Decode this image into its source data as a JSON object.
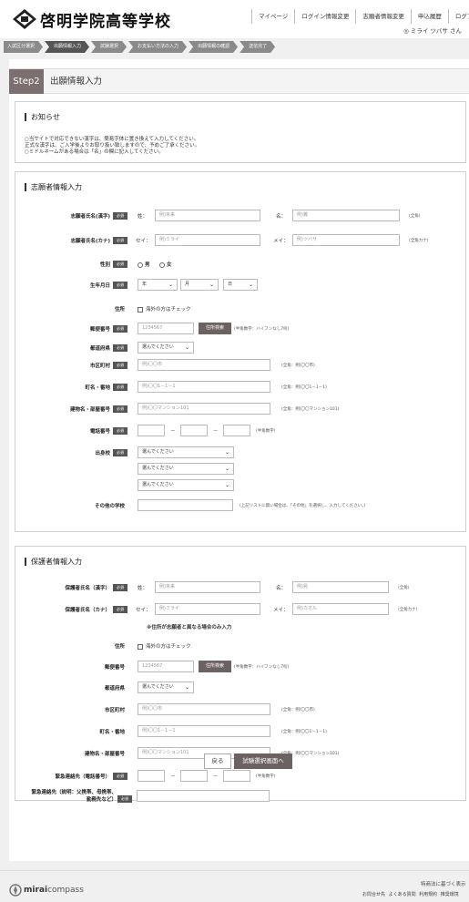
{
  "header": {
    "school_name": "啓明学院高等学校",
    "nav": [
      "マイページ",
      "ログイン情報変更",
      "志願者情報変更",
      "申込履歴",
      "ログアウト"
    ],
    "user_name": "ミライ ツバサ さん"
  },
  "breadcrumbs": [
    "入試区分選択",
    "出願情報入力",
    "試験選択",
    "お支払い方法の入力",
    "出願情報の確認",
    "送信完了"
  ],
  "step": {
    "badge": "Step2",
    "title": "出願情報入力"
  },
  "notice": {
    "title": "お知らせ",
    "lines": [
      "○当サイトで対応できない漢字は、簡易字体に置き換えて入力してください。",
      "正式な漢字は、ご入学後よりお取り扱い致しますので、予めご了承ください。",
      "○ミドルネームがある場合は「名」の欄に記入してください。"
    ]
  },
  "applicant": {
    "title": "志願者情報入力",
    "required": "必須",
    "name_kanji": {
      "label": "志願者氏名(漢字)",
      "sei": "姓：",
      "mei": "名：",
      "sei_ph": "例)未来",
      "mei_ph": "例)翼",
      "hint": "(全角)"
    },
    "name_kana": {
      "label": "志願者氏名(カナ)",
      "sei": "セイ：",
      "mei": "メイ：",
      "sei_ph": "例)ミライ",
      "mei_ph": "例)ツバサ",
      "hint": "(全角カナ)"
    },
    "gender": {
      "label": "性別",
      "male": "男",
      "female": "女"
    },
    "birthday": {
      "label": "生年月日",
      "year": "年",
      "month": "月",
      "day": "日"
    },
    "address_label": "住所",
    "overseas": "海外の方はチェック",
    "zip": {
      "label": "郵便番号",
      "ph": "1234567",
      "button": "住所検索",
      "hint": "(半角数字：ハイフンなし7桁)"
    },
    "pref": {
      "label": "都道府県",
      "value": "選んでください"
    },
    "city": {
      "label": "市区町村",
      "ph": "例)〇〇市",
      "hint": "(全角：例)〇〇市)"
    },
    "town": {
      "label": "町名・番地",
      "ph": "例)〇〇1－1－1",
      "hint": "(全角：例)〇〇1－1－1)"
    },
    "building": {
      "label": "建物名・部屋番号",
      "ph": "例)〇〇マンション101",
      "hint": "(全角：例)〇〇マンション101)"
    },
    "phone": {
      "label": "電話番号",
      "hint": "(半角数字)"
    },
    "school": {
      "label": "出身校",
      "value": "選んでください"
    },
    "other_school": {
      "label": "その他の学校",
      "hint": "(上記リストに無い場合は、「その他」を選択し、入力してください。)"
    }
  },
  "guardian": {
    "title": "保護者情報入力",
    "required": "必須",
    "name_kanji": {
      "label": "保護者氏名（漢字）",
      "sei": "姓：",
      "mei": "名：",
      "sei_ph": "例)未来",
      "mei_ph": "例)晃",
      "hint": "(全角)"
    },
    "name_kana": {
      "label": "保護者氏名（カナ）",
      "sei": "セイ：",
      "mei": "メイ：",
      "sei_ph": "例)ミライ",
      "mei_ph": "例)カオル",
      "hint": "(全角カナ)"
    },
    "address_note": "※住所が志願者と異なる場合のみ入力",
    "address_label": "住所",
    "overseas": "海外の方はチェック",
    "zip": {
      "label": "郵便番号",
      "ph": "1234567",
      "button": "住所検索",
      "hint": "(半角数字：ハイフンなし7桁)"
    },
    "pref": {
      "label": "都道府県",
      "value": "選んでください"
    },
    "city": {
      "label": "市区町村",
      "ph": "例)〇〇市",
      "hint": "(全角：例)〇〇市)"
    },
    "town": {
      "label": "町名・番地",
      "ph": "例)〇〇1－1－1",
      "hint": "(全角：例)〇〇1－1－1)"
    },
    "building": {
      "label": "建物名・部屋番号",
      "ph": "例)〇〇マンション101",
      "hint": "(全角：例)〇〇マンション101)"
    },
    "emergency": {
      "label": "緊急連絡先（電話番号）",
      "hint": "(半角数字)"
    },
    "emergency_desc": {
      "label1": "緊急連絡先（説明：父携帯、母携帯、",
      "label2": "勤務先など）"
    }
  },
  "actions": {
    "back": "戻る",
    "next": "試験選択画面へ"
  },
  "footer": {
    "brand_bold": "mirai",
    "brand": "compass",
    "law": "特商法に基づく表示",
    "links": "お問合せ先 よくある質問 利用規約 推奨環境"
  }
}
